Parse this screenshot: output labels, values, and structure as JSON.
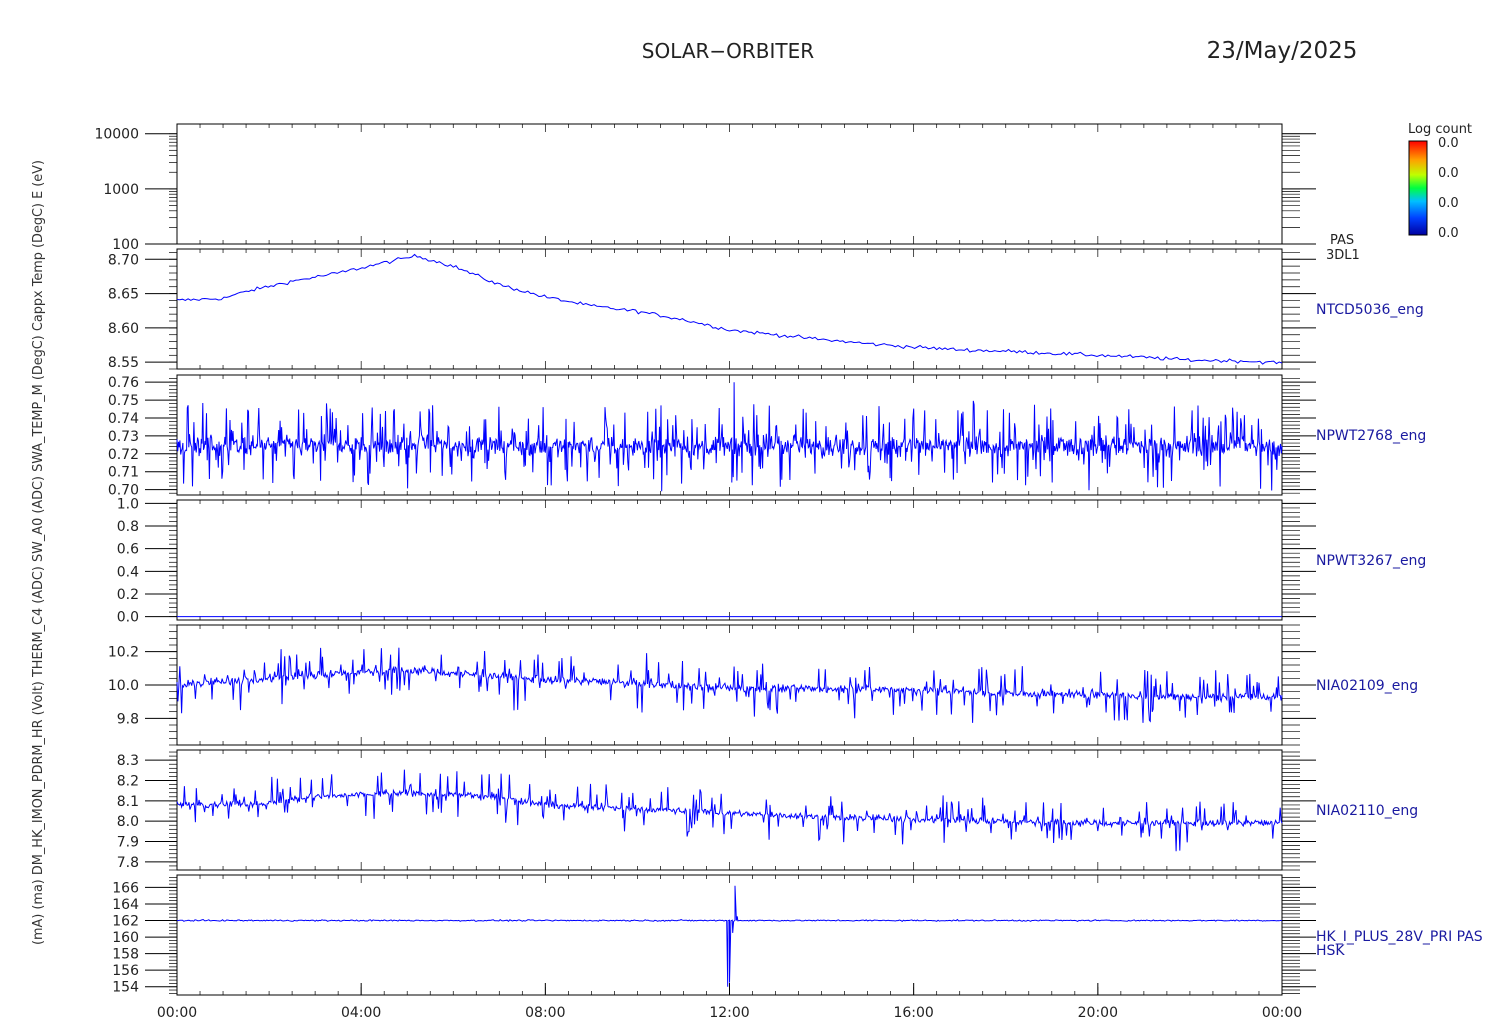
{
  "header": {
    "title": "SOLAR−ORBITER",
    "date": "23/May/2025"
  },
  "colorbar": {
    "title": "Log count",
    "ticks": [
      "0.0",
      "0.0",
      "0.0",
      "0.0"
    ]
  },
  "overlapped_ylabel": "(mA) (ma) DM_HK_IMON_PDRM_HR (Volt) THERM_C4 (ADC) SW_A0 (ADC) SWA_TEMP_M (DegC) Cappx Temp (DegC) E (eV)",
  "colors": {
    "trace": "#0000ff",
    "axes": "#000000",
    "label": "#1a1aa0"
  },
  "chart_data": {
    "type": "line",
    "x": {
      "start": "00:00",
      "end": "00:00",
      "ticks": [
        "00:00",
        "04:00",
        "08:00",
        "12:00",
        "16:00",
        "20:00",
        "00:00"
      ]
    },
    "panels": [
      {
        "id": "p0",
        "type": "heatmap",
        "scale": "log",
        "ylim": [
          100,
          15000
        ],
        "yticks": [
          100,
          1000,
          10000
        ],
        "ytick_labels": [
          "100",
          "1000",
          "10000"
        ],
        "right_label": "PAS",
        "right_label2": "3DL1",
        "values": []
      },
      {
        "id": "p1",
        "ylim": [
          8.54,
          8.715
        ],
        "yticks": [
          8.55,
          8.6,
          8.65,
          8.7
        ],
        "ytick_labels": [
          "8.55",
          "8.60",
          "8.65",
          "8.70"
        ],
        "right_label": "NTCD5036_eng",
        "knots": [
          [
            0,
            8.64
          ],
          [
            1,
            8.643
          ],
          [
            1.5,
            8.653
          ],
          [
            2.5,
            8.668
          ],
          [
            3.5,
            8.68
          ],
          [
            4.5,
            8.695
          ],
          [
            5.2,
            8.705
          ],
          [
            6,
            8.69
          ],
          [
            7,
            8.663
          ],
          [
            8,
            8.645
          ],
          [
            9,
            8.632
          ],
          [
            10,
            8.624
          ],
          [
            11,
            8.612
          ],
          [
            12,
            8.597
          ],
          [
            13,
            8.59
          ],
          [
            14,
            8.583
          ],
          [
            15,
            8.577
          ],
          [
            16,
            8.572
          ],
          [
            17,
            8.568
          ],
          [
            18,
            8.566
          ],
          [
            19,
            8.563
          ],
          [
            20,
            8.56
          ],
          [
            21,
            8.557
          ],
          [
            22,
            8.553
          ],
          [
            23,
            8.552
          ],
          [
            24,
            8.549
          ]
        ],
        "noise": 0.0025,
        "spike": 0.0,
        "spike_rate": 0,
        "points": 400
      },
      {
        "id": "p2",
        "ylim": [
          0.697,
          0.764
        ],
        "yticks": [
          0.7,
          0.71,
          0.72,
          0.73,
          0.74,
          0.75,
          0.76
        ],
        "ytick_labels": [
          "0.70",
          "0.71",
          "0.72",
          "0.73",
          "0.74",
          "0.75",
          "0.76"
        ],
        "right_label": "NPWT2768_eng",
        "knots": [
          [
            0,
            0.7245
          ],
          [
            24,
            0.7245
          ]
        ],
        "noise": 0.005,
        "spike": 0.022,
        "spike_rate": 0.3,
        "points": 1500,
        "events": [
          [
            12.1,
            0.76
          ],
          [
            12.05,
            0.704
          ]
        ]
      },
      {
        "id": "p3",
        "ylim": [
          -0.03,
          1.03
        ],
        "yticks": [
          0.0,
          0.2,
          0.4,
          0.6,
          0.8,
          1.0
        ],
        "ytick_labels": [
          "0.0",
          "0.2",
          "0.4",
          "0.6",
          "0.8",
          "1.0"
        ],
        "right_label": "NPWT3267_eng",
        "knots": [
          [
            0,
            0.0
          ],
          [
            24,
            0.0
          ]
        ],
        "noise": 0.0,
        "spike": 0.0,
        "spike_rate": 0,
        "points": 60
      },
      {
        "id": "p4",
        "ylim": [
          9.64,
          10.36
        ],
        "yticks": [
          9.8,
          10.0,
          10.2
        ],
        "ytick_labels": [
          "9.8",
          "10.0",
          "10.2"
        ],
        "right_label": "NIA02109_eng",
        "knots": [
          [
            0,
            10.0
          ],
          [
            1,
            10.02
          ],
          [
            2,
            10.04
          ],
          [
            3,
            10.06
          ],
          [
            4,
            10.08
          ],
          [
            5,
            10.09
          ],
          [
            6,
            10.07
          ],
          [
            7,
            10.05
          ],
          [
            8,
            10.03
          ],
          [
            10,
            10.01
          ],
          [
            12,
            9.98
          ],
          [
            14,
            9.98
          ],
          [
            16,
            9.97
          ],
          [
            18,
            9.95
          ],
          [
            20,
            9.94
          ],
          [
            22,
            9.93
          ],
          [
            24,
            9.93
          ]
        ],
        "noise": 0.022,
        "spike": 0.17,
        "spike_rate": 0.22,
        "points": 1200
      },
      {
        "id": "p5",
        "ylim": [
          7.76,
          8.35
        ],
        "yticks": [
          7.8,
          7.9,
          8.0,
          8.1,
          8.2,
          8.3
        ],
        "ytick_labels": [
          "7.8",
          "7.9",
          "8.0",
          "8.1",
          "8.2",
          "8.3"
        ],
        "right_label": "NIA02110_eng",
        "knots": [
          [
            0,
            8.08
          ],
          [
            2,
            8.09
          ],
          [
            3,
            8.12
          ],
          [
            5,
            8.14
          ],
          [
            7,
            8.12
          ],
          [
            8,
            8.08
          ],
          [
            10,
            8.06
          ],
          [
            12,
            8.04
          ],
          [
            14,
            8.02
          ],
          [
            16,
            8.01
          ],
          [
            18,
            8.0
          ],
          [
            20,
            7.99
          ],
          [
            22,
            7.99
          ],
          [
            24,
            7.99
          ]
        ],
        "noise": 0.015,
        "spike": 0.12,
        "spike_rate": 0.22,
        "points": 1200
      },
      {
        "id": "p6",
        "ylim": [
          153,
          167.5
        ],
        "yticks": [
          154,
          156,
          158,
          160,
          162,
          164,
          166
        ],
        "ytick_labels": [
          "154",
          "156",
          "158",
          "160",
          "162",
          "164",
          "166"
        ],
        "right_label": "HK_I_PLUS_28V_PRI PAS",
        "right_label2": "HSK",
        "knots": [
          [
            0,
            162
          ],
          [
            24,
            162
          ]
        ],
        "noise": 0.08,
        "spike": 0.0,
        "spike_rate": 0,
        "points": 800,
        "events": [
          [
            11.96,
            154.0
          ],
          [
            12.0,
            154.5
          ],
          [
            12.07,
            160.5
          ],
          [
            12.12,
            166.2
          ],
          [
            12.17,
            162.5
          ]
        ]
      }
    ]
  }
}
